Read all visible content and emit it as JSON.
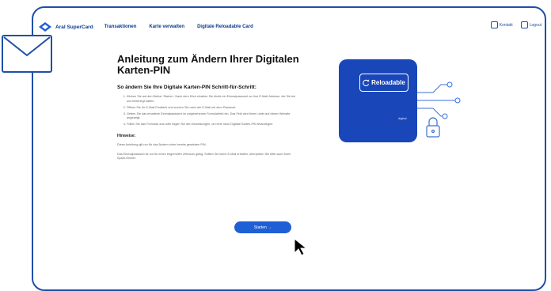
{
  "app": {
    "brand": "Aral SuperCard",
    "nav_links": [
      "Transaktionen",
      "Karte verwalten",
      "Digitale Reloadable Card"
    ],
    "nav_right": [
      {
        "label": "Kontakt",
        "icon": "headset-icon"
      },
      {
        "label": "Logout",
        "icon": "logout-icon"
      }
    ]
  },
  "main": {
    "title": "Anleitung zum Ändern Ihrer Digitalen Karten-PIN",
    "subtitle": "So ändern Sie Ihre Digitale Karten-PIN Schritt-für-Schritt:",
    "steps": [
      "Klicken Sie auf den Button 'Starten'. Nach dem Klick erhalten Sie direkt ein Einmalpasswort an Ihre E-Mail-Adresse, die Sie bei uns hinterlegt haben.",
      "Öffnen Sie Ihr E-Mail-Postfach und suchen Sie nach der E-Mail mit dem Passwort.",
      "Geben Sie das erhaltene Einmalpasswort im vorgesehenen Formularfeld ein. Das Feld wird Ihnen unter auf dieser Website angezeigt.",
      "Füllen Sie das Formular aus oder folgen Sie den Anweisungen, um eine neue Digitale Karten-PIN festzulegen."
    ],
    "hints_title": "Hinweise:",
    "hints": [
      "Diese Anleitung gilt nur für das Ändern einer bereits gesetzten PIN.",
      "Das Einmalpasswort ist nur für einen begrenzten Zeitraum gültig. Sollten Sie keine E-Mail erhalten, überprüfen Sie bitte auch Ihren Spam-Ordner."
    ],
    "start_button": "Starten →"
  },
  "card": {
    "label": "Reloadable",
    "sub": "digital"
  },
  "colors": {
    "frame": "#1f4fa8",
    "card_bg": "#1947b9",
    "button": "#1f5fd6"
  }
}
